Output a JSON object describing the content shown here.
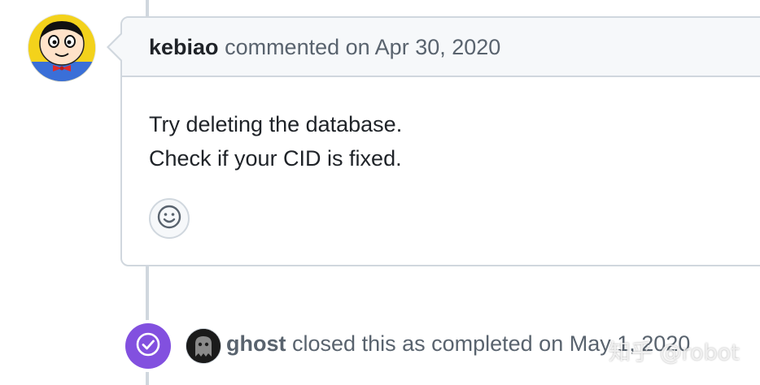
{
  "comment": {
    "author": "kebiao",
    "meta": "commented on Apr 30, 2020",
    "body_lines": [
      "Try deleting the database.",
      "Check if your CID is fixed."
    ],
    "reaction_icon": "smiley-icon"
  },
  "event": {
    "actor": "ghost",
    "text": "closed this as completed on May 1, 2020",
    "badge_icon": "check-circle-icon",
    "badge_color": "#8250df"
  },
  "watermark": {
    "text": "知乎 @robot"
  },
  "colors": {
    "border": "#d0d7de",
    "header_bg": "#f6f8fa",
    "muted_text": "#59636e",
    "primary_text": "#1f2328"
  }
}
